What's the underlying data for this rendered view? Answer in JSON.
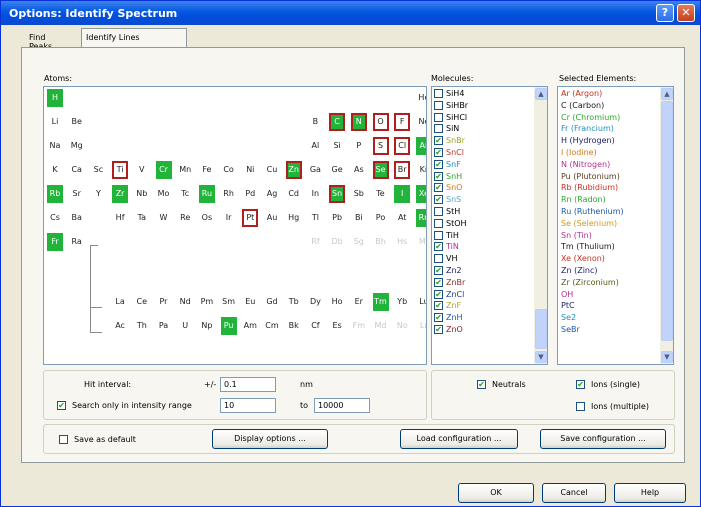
{
  "window": {
    "title": "Options: Identify Spectrum",
    "help": "?",
    "close": "✕"
  },
  "tabs": [
    "Find Peaks",
    "Identify Lines"
  ],
  "atoms": {
    "label": "Atoms:"
  },
  "periodic_rows": [
    [
      [
        "H",
        "g"
      ],
      [
        "",
        "sp"
      ],
      [
        "He",
        ""
      ]
    ],
    [
      [
        "Li",
        ""
      ],
      [
        "Be",
        ""
      ],
      [
        "",
        "sp"
      ],
      [
        "B",
        ""
      ],
      [
        "C",
        "go"
      ],
      [
        "N",
        "go"
      ],
      [
        "O",
        "o"
      ],
      [
        "F",
        "o"
      ],
      [
        "Ne",
        ""
      ]
    ],
    [
      [
        "Na",
        ""
      ],
      [
        "Mg",
        ""
      ],
      [
        "",
        "sp"
      ],
      [
        "Al",
        ""
      ],
      [
        "Si",
        ""
      ],
      [
        "P",
        ""
      ],
      [
        "S",
        "o"
      ],
      [
        "Cl",
        "o"
      ],
      [
        "Ar",
        "g"
      ]
    ],
    [
      [
        "K",
        ""
      ],
      [
        "Ca",
        ""
      ],
      [
        "Sc",
        ""
      ],
      [
        "Ti",
        "o"
      ],
      [
        "V",
        ""
      ],
      [
        "Cr",
        "g"
      ],
      [
        "Mn",
        ""
      ],
      [
        "Fe",
        ""
      ],
      [
        "Co",
        ""
      ],
      [
        "Ni",
        ""
      ],
      [
        "Cu",
        ""
      ],
      [
        "Zn",
        "go"
      ],
      [
        "Ga",
        ""
      ],
      [
        "Ge",
        ""
      ],
      [
        "As",
        ""
      ],
      [
        "Se",
        "go"
      ],
      [
        "Br",
        "o"
      ],
      [
        "Kr",
        ""
      ]
    ],
    [
      [
        "Rb",
        "g"
      ],
      [
        "Sr",
        ""
      ],
      [
        "Y",
        ""
      ],
      [
        "Zr",
        "g"
      ],
      [
        "Nb",
        ""
      ],
      [
        "Mo",
        ""
      ],
      [
        "Tc",
        ""
      ],
      [
        "Ru",
        "g"
      ],
      [
        "Rh",
        ""
      ],
      [
        "Pd",
        ""
      ],
      [
        "Ag",
        ""
      ],
      [
        "Cd",
        ""
      ],
      [
        "In",
        ""
      ],
      [
        "Sn",
        "go"
      ],
      [
        "Sb",
        ""
      ],
      [
        "Te",
        ""
      ],
      [
        "I",
        "g"
      ],
      [
        "Xe",
        "g"
      ]
    ],
    [
      [
        "Cs",
        ""
      ],
      [
        "Ba",
        ""
      ],
      [
        "",
        "sp"
      ],
      [
        "Hf",
        ""
      ],
      [
        "Ta",
        ""
      ],
      [
        "W",
        ""
      ],
      [
        "Re",
        ""
      ],
      [
        "Os",
        ""
      ],
      [
        "Ir",
        ""
      ],
      [
        "Pt",
        "o"
      ],
      [
        "Au",
        ""
      ],
      [
        "Hg",
        ""
      ],
      [
        "Tl",
        ""
      ],
      [
        "Pb",
        ""
      ],
      [
        "Bi",
        ""
      ],
      [
        "Po",
        ""
      ],
      [
        "At",
        ""
      ],
      [
        "Rn",
        "g"
      ]
    ],
    [
      [
        "Fr",
        "g"
      ],
      [
        "Ra",
        ""
      ],
      [
        "",
        "sp"
      ],
      [
        "Rf",
        "d"
      ],
      [
        "Db",
        "d"
      ],
      [
        "Sg",
        "d"
      ],
      [
        "Bh",
        "d"
      ],
      [
        "Hs",
        "d"
      ],
      [
        "Mt",
        "d"
      ]
    ]
  ],
  "f_rows": [
    [
      [
        "La",
        ""
      ],
      [
        "Ce",
        ""
      ],
      [
        "Pr",
        ""
      ],
      [
        "Nd",
        ""
      ],
      [
        "Pm",
        ""
      ],
      [
        "Sm",
        ""
      ],
      [
        "Eu",
        ""
      ],
      [
        "Gd",
        ""
      ],
      [
        "Tb",
        ""
      ],
      [
        "Dy",
        ""
      ],
      [
        "Ho",
        ""
      ],
      [
        "Er",
        ""
      ],
      [
        "Tm",
        "g"
      ],
      [
        "Yb",
        ""
      ],
      [
        "Lu",
        ""
      ]
    ],
    [
      [
        "Ac",
        ""
      ],
      [
        "Th",
        ""
      ],
      [
        "Pa",
        ""
      ],
      [
        "U",
        ""
      ],
      [
        "Np",
        ""
      ],
      [
        "Pu",
        "g"
      ],
      [
        "Am",
        ""
      ],
      [
        "Cm",
        ""
      ],
      [
        "Bk",
        ""
      ],
      [
        "Cf",
        ""
      ],
      [
        "Es",
        ""
      ],
      [
        "Fm",
        "d"
      ],
      [
        "Md",
        "d"
      ],
      [
        "No",
        "d"
      ],
      [
        "Lr",
        "d"
      ]
    ]
  ],
  "molecules": {
    "label": "Molecules:",
    "items": [
      [
        "SiH4",
        false,
        "#000000"
      ],
      [
        "SiHBr",
        false,
        "#000000"
      ],
      [
        "SiHCl",
        false,
        "#000000"
      ],
      [
        "SiN",
        false,
        "#000000"
      ],
      [
        "SnBr",
        true,
        "#9ca62a"
      ],
      [
        "SnCl",
        true,
        "#c0331e"
      ],
      [
        "SnF",
        true,
        "#1f8fbf"
      ],
      [
        "SnH",
        true,
        "#2ba82b"
      ],
      [
        "SnO",
        true,
        "#d07a1a"
      ],
      [
        "SnS",
        true,
        "#5aa6c8"
      ],
      [
        "StH",
        false,
        "#000000"
      ],
      [
        "StOH",
        false,
        "#000000"
      ],
      [
        "TiH",
        false,
        "#000000"
      ],
      [
        "TiN",
        true,
        "#b22f8f"
      ],
      [
        "VH",
        false,
        "#000000"
      ],
      [
        "Zn2",
        true,
        "#1a1a6b"
      ],
      [
        "ZnBr",
        true,
        "#8b3030"
      ],
      [
        "ZnCl",
        true,
        "#1f3f8f"
      ],
      [
        "ZnF",
        true,
        "#a8a82a"
      ],
      [
        "ZnH",
        true,
        "#1a5aa8"
      ],
      [
        "ZnO",
        true,
        "#8b1a1a"
      ]
    ]
  },
  "selected": {
    "label": "Selected Elements:",
    "items": [
      [
        "Ar (Argon)",
        "#c0331e"
      ],
      [
        "C (Carbon)",
        "#1a1a1a"
      ],
      [
        "Cr (Chromium)",
        "#2ba82b"
      ],
      [
        "Fr (Francium)",
        "#1f8fbf"
      ],
      [
        "H (Hydrogen)",
        "#1a1a6b"
      ],
      [
        "I (Iodine)",
        "#d07a1a"
      ],
      [
        "N (Nitrogen)",
        "#b22f8f"
      ],
      [
        "Pu (Plutonium)",
        "#5a3a1a"
      ],
      [
        "Rb (Rubidium)",
        "#c0331e"
      ],
      [
        "Rn (Radon)",
        "#2ba82b"
      ],
      [
        "Ru (Ruthenium)",
        "#1a5aa8"
      ],
      [
        "Se (Selenium)",
        "#d09a1a"
      ],
      [
        "Sn (Tin)",
        "#b22f8f"
      ],
      [
        "Tm (Thulium)",
        "#1a1a1a"
      ],
      [
        "Xe (Xenon)",
        "#c0331e"
      ],
      [
        "Zn (Zinc)",
        "#1a1a6b"
      ],
      [
        "Zr (Zirconium)",
        "#5a5a1a"
      ],
      [
        "OH",
        "#b22f8f"
      ],
      [
        "PtC",
        "#1a1a6b"
      ],
      [
        "Se2",
        "#1f8fbf"
      ],
      [
        "SeBr",
        "#1a5aa8"
      ]
    ]
  },
  "search": {
    "hit_interval_label": "Hit interval:",
    "pm": "+/-",
    "hit_interval": "0.1",
    "nm": "nm",
    "range_label": "Search only in intensity range",
    "range_checked": true,
    "range_from": "10",
    "to": "to",
    "range_to": "10000"
  },
  "options": {
    "neutrals": "Neutrals",
    "neutrals_checked": true,
    "ions_single": "Ions (single)",
    "ions_single_checked": true,
    "ions_multiple": "Ions (multiple)",
    "ions_multiple_checked": false
  },
  "bottom": {
    "save_default": "Save as default",
    "display": "Display options ...",
    "load": "Load configuration ...",
    "save": "Save configuration ..."
  },
  "footer": {
    "ok": "OK",
    "cancel": "Cancel",
    "help": "Help"
  },
  "colors": {
    "title_bar": "#0a5be0",
    "highlight": "#22b43a",
    "outline": "#b11e1e"
  }
}
